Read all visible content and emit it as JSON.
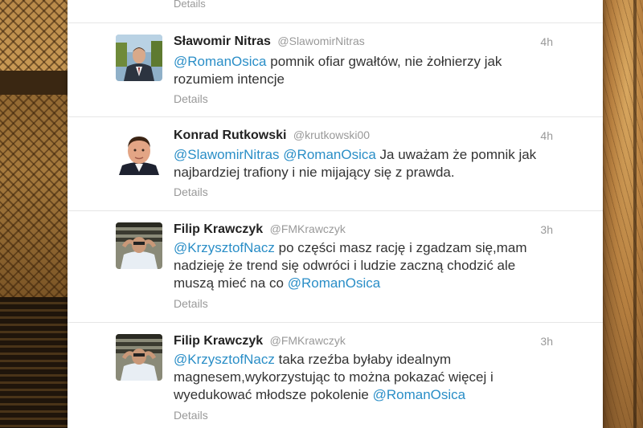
{
  "top_details_label": "Details",
  "tweets": [
    {
      "name": "Sławomir Nitras",
      "handle": "@SlawomirNitras",
      "time": "4h",
      "segments": [
        {
          "type": "mention",
          "text": "@RomanOsica"
        },
        {
          "type": "text",
          "text": " pomnik ofiar gwałtów, nie żołnierzy jak rozumiem intencje"
        }
      ],
      "details": "Details"
    },
    {
      "name": "Konrad Rutkowski",
      "handle": "@krutkowski00",
      "time": "4h",
      "segments": [
        {
          "type": "mention",
          "text": "@SlawomirNitras"
        },
        {
          "type": "text",
          "text": " "
        },
        {
          "type": "mention",
          "text": "@RomanOsica"
        },
        {
          "type": "text",
          "text": " Ja uważam że pomnik jak najbardziej trafiony i nie mijający się z prawda."
        }
      ],
      "details": "Details"
    },
    {
      "name": "Filip Krawczyk",
      "handle": "@FMKrawczyk",
      "time": "3h",
      "segments": [
        {
          "type": "mention",
          "text": "@KrzysztofNacz"
        },
        {
          "type": "text",
          "text": " po części masz rację i zgadzam się,mam nadzieję że trend się odwróci i ludzie zaczną chodzić ale muszą mieć na co "
        },
        {
          "type": "mention",
          "text": "@RomanOsica"
        }
      ],
      "details": "Details"
    },
    {
      "name": "Filip Krawczyk",
      "handle": "@FMKrawczyk",
      "time": "3h",
      "segments": [
        {
          "type": "mention",
          "text": "@KrzysztofNacz"
        },
        {
          "type": "text",
          "text": " taka rzeźba byłaby idealnym magnesem,wykorzystując to można pokazać więcej i wyedukować młodsze pokolenie  "
        },
        {
          "type": "mention",
          "text": "@RomanOsica"
        }
      ],
      "details": "Details"
    }
  ],
  "colors": {
    "mention": "#2a8ec7",
    "name": "#222222",
    "meta": "#999999",
    "text": "#333333"
  }
}
